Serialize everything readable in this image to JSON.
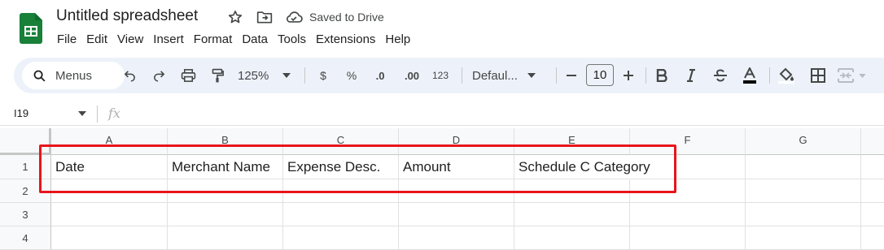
{
  "app": {
    "title": "Untitled spreadsheet",
    "saved_status": "Saved to Drive",
    "logo_icon": "sheets-logo-icon",
    "brand_color": "#188038"
  },
  "menu": [
    "File",
    "Edit",
    "View",
    "Insert",
    "Format",
    "Data",
    "Tools",
    "Extensions",
    "Help"
  ],
  "toolbar": {
    "search_label": "Menus",
    "zoom": "125%",
    "currency": "$",
    "percent": "%",
    "decrease_decimal": ".0",
    "increase_decimal": ".00",
    "number_format": "123",
    "font": "Defaul...",
    "font_size": "10",
    "icons": [
      "search-icon",
      "undo-icon",
      "redo-icon",
      "print-icon",
      "paint-format-icon",
      "minus-icon",
      "plus-icon",
      "bold-icon",
      "italic-icon",
      "strikethrough-icon",
      "text-color-icon",
      "fill-color-icon",
      "borders-icon",
      "merge-cells-icon"
    ]
  },
  "formula_bar": {
    "cell_ref": "I19",
    "fx": "fx"
  },
  "sheet": {
    "columns": [
      "A",
      "B",
      "C",
      "D",
      "E",
      "F",
      "G"
    ],
    "rows": [
      "1",
      "2",
      "3",
      "4"
    ],
    "row1": [
      "Date",
      "Merchant Name",
      "Expense Desc.",
      "Amount",
      "Schedule C Category",
      "",
      ""
    ],
    "highlight_color": "#e8151b"
  }
}
